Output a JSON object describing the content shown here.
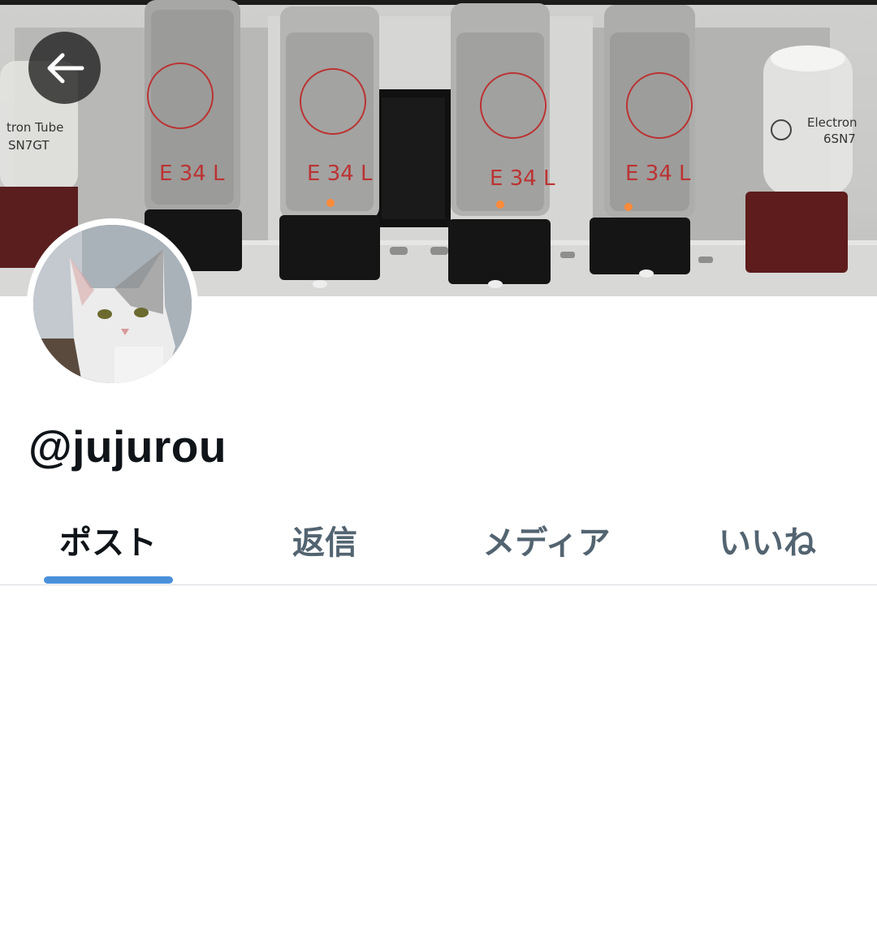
{
  "header": {
    "back_icon": "arrow-left-icon"
  },
  "banner": {
    "tube_labels": {
      "left_small_line1": "tron Tube",
      "left_small_line2": "SN7GT",
      "right_small_line1": "Electron",
      "right_small_line2": "6SN7",
      "power_tube": "E 34 L"
    }
  },
  "profile": {
    "handle": "@jujurou"
  },
  "tabs": [
    {
      "label": "ポスト",
      "active": true
    },
    {
      "label": "返信",
      "active": false
    },
    {
      "label": "メディア",
      "active": false
    },
    {
      "label": "いいね",
      "active": false
    }
  ],
  "colors": {
    "accent": "#4a90d9",
    "text_primary": "#0f1419",
    "text_secondary": "#536471",
    "divider": "#d9dde1"
  }
}
